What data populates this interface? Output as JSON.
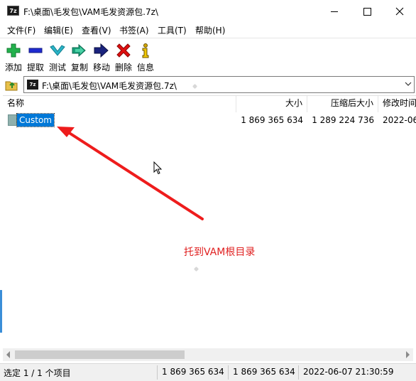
{
  "window": {
    "title": "F:\\桌面\\毛发包\\VAM毛发资源包.7z\\",
    "app_icon_text": "7z"
  },
  "menu": {
    "items": [
      {
        "label": "文件(F)"
      },
      {
        "label": "编辑(E)"
      },
      {
        "label": "查看(V)"
      },
      {
        "label": "书签(A)"
      },
      {
        "label": "工具(T)"
      },
      {
        "label": "帮助(H)"
      }
    ]
  },
  "toolbar": {
    "buttons": [
      {
        "label": "添加",
        "icon": "plus-icon",
        "color": "#22b14c"
      },
      {
        "label": "提取",
        "icon": "minus-icon",
        "color": "#1f2bd1"
      },
      {
        "label": "测试",
        "icon": "checkmark-icon",
        "color": "#2ab3c7"
      },
      {
        "label": "复制",
        "icon": "double-arrow-icon",
        "color": "#1aa07a"
      },
      {
        "label": "移动",
        "icon": "arrow-right-icon",
        "color": "#1a237e"
      },
      {
        "label": "删除",
        "icon": "x-icon",
        "color": "#e01010"
      },
      {
        "label": "信息",
        "icon": "info-icon",
        "color": "#d4a800"
      }
    ]
  },
  "address": {
    "path": "F:\\桌面\\毛发包\\VAM毛发资源包.7z\\",
    "icon_text": "7z"
  },
  "list": {
    "columns": {
      "name": "名称",
      "size": "大小",
      "packed": "压缩后大小",
      "modified": "修改时间"
    },
    "rows": [
      {
        "name": "Custom",
        "size": "1 869 365 634",
        "packed": "1 289 224 736",
        "modified": "2022-06"
      }
    ]
  },
  "annotation": {
    "text": "托到VAM根目录",
    "color": "#e02020"
  },
  "status": {
    "selection": "选定 1 / 1 个项目",
    "size": "1 869 365 634",
    "size2": "1 869 365 634",
    "datetime": "2022-06-07 21:30:59"
  }
}
